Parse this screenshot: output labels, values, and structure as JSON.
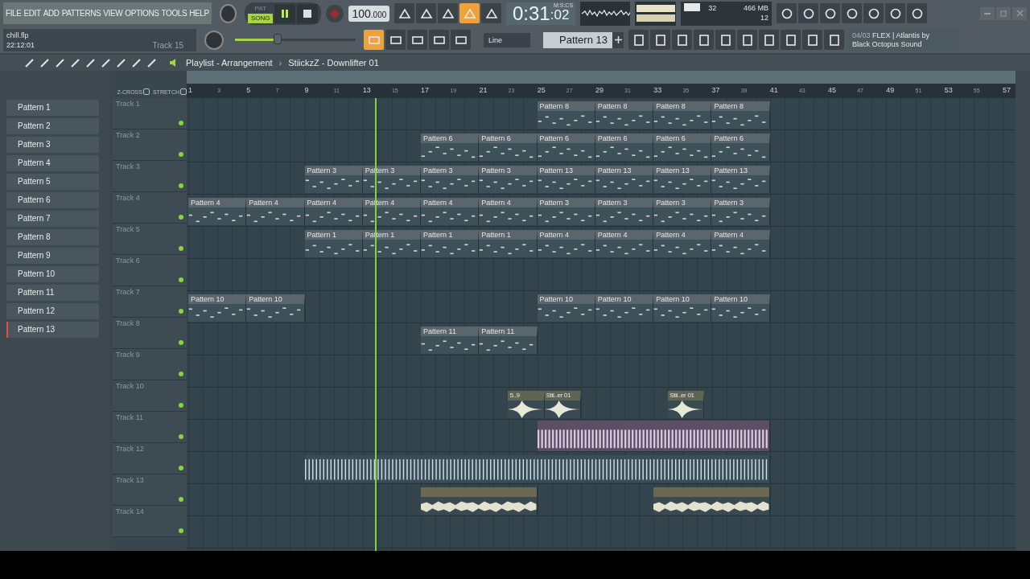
{
  "menu": [
    "FILE",
    "EDIT",
    "ADD",
    "PATTERNS",
    "VIEW",
    "OPTIONS",
    "TOOLS",
    "HELP"
  ],
  "project": {
    "file": "chill.flp",
    "time": "22:12:01",
    "hint": "Track 15"
  },
  "transport": {
    "modes": [
      {
        "label": "PAT",
        "selected": false
      },
      {
        "label": "SONG",
        "selected": true
      }
    ],
    "playing": true,
    "recording": false,
    "tempo": "100",
    "tempo_fraction": ".000"
  },
  "master_volume": {
    "level": 0.35
  },
  "clock": {
    "main": "0:31",
    "fraction": ":02",
    "unit": "M:S:CS"
  },
  "cpu": {
    "polyphony": "32",
    "memory": "466 MB",
    "voices": "12"
  },
  "snap": "Line",
  "current_pattern": "Pattern 13",
  "news": {
    "index": "04/03",
    "line1": "FLEX | Atlantis by",
    "line2": "Black Octopus Sound"
  },
  "playlist": {
    "title": "Playlist - Arrangement",
    "separator": "›",
    "clip_source": "StiickzZ - Downlifter 01",
    "options": [
      {
        "label": "Z-CROSS",
        "checked": false
      },
      {
        "label": "STRETCH",
        "checked": false
      }
    ],
    "ruler": [
      "1",
      "3",
      "5",
      "7",
      "9",
      "11",
      "13",
      "15",
      "17",
      "19",
      "21",
      "23",
      "25",
      "27",
      "29",
      "31",
      "33",
      "35",
      "37",
      "39",
      "41",
      "43",
      "45",
      "47",
      "49",
      "51",
      "53",
      "55",
      "57"
    ],
    "playhead": {
      "level": 0.227
    },
    "patterns": [
      {
        "name": "Pattern 1",
        "selected": false
      },
      {
        "name": "Pattern 2",
        "selected": false
      },
      {
        "name": "Pattern 3",
        "selected": false
      },
      {
        "name": "Pattern 4",
        "selected": false
      },
      {
        "name": "Pattern 5",
        "selected": false
      },
      {
        "name": "Pattern 6",
        "selected": false
      },
      {
        "name": "Pattern 7",
        "selected": false
      },
      {
        "name": "Pattern 8",
        "selected": false
      },
      {
        "name": "Pattern 9",
        "selected": false
      },
      {
        "name": "Pattern 10",
        "selected": false
      },
      {
        "name": "Pattern 11",
        "selected": false
      },
      {
        "name": "Pattern 12",
        "selected": false
      },
      {
        "name": "Pattern 13",
        "selected": true
      }
    ],
    "tracks": [
      {
        "name": "Track 1",
        "on": true,
        "clips": [
          {
            "kind": "gap"
          },
          {
            "kind": "gap"
          },
          {
            "kind": "gap"
          },
          {
            "kind": "gap"
          },
          {
            "kind": "gap"
          },
          {
            "kind": "gap"
          },
          {
            "kind": "pattern",
            "label": "Pattern 8"
          },
          {
            "kind": "pattern",
            "label": "Pattern 8"
          },
          {
            "kind": "pattern",
            "label": "Pattern 8"
          },
          {
            "kind": "pattern",
            "label": "Pattern 8"
          }
        ]
      },
      {
        "name": "Track 2",
        "on": true,
        "clips": [
          {
            "kind": "gap"
          },
          {
            "kind": "gap"
          },
          {
            "kind": "gap"
          },
          {
            "kind": "gap"
          },
          {
            "kind": "pattern",
            "label": "Pattern 6"
          },
          {
            "kind": "pattern",
            "label": "Pattern 6"
          },
          {
            "kind": "pattern",
            "label": "Pattern 6"
          },
          {
            "kind": "pattern",
            "label": "Pattern 6"
          },
          {
            "kind": "pattern",
            "label": "Pattern 6"
          },
          {
            "kind": "pattern",
            "label": "Pattern 6"
          }
        ]
      },
      {
        "name": "Track 3",
        "on": true,
        "clips": [
          {
            "kind": "gap"
          },
          {
            "kind": "gap"
          },
          {
            "kind": "pattern",
            "label": "Pattern 3"
          },
          {
            "kind": "pattern",
            "label": "Pattern 3"
          },
          {
            "kind": "pattern",
            "label": "Pattern 3"
          },
          {
            "kind": "pattern",
            "label": "Pattern 3"
          },
          {
            "kind": "pattern",
            "label": "Pattern 13"
          },
          {
            "kind": "pattern",
            "label": "Pattern 13"
          },
          {
            "kind": "pattern",
            "label": "Pattern 13"
          },
          {
            "kind": "pattern",
            "label": "Pattern 13"
          }
        ]
      },
      {
        "name": "Track 4",
        "on": true,
        "clips": [
          {
            "kind": "pattern",
            "label": "Pattern 4"
          },
          {
            "kind": "pattern",
            "label": "Pattern 4"
          },
          {
            "kind": "pattern",
            "label": "Pattern 4"
          },
          {
            "kind": "pattern",
            "label": "Pattern 4"
          },
          {
            "kind": "pattern",
            "label": "Pattern 4"
          },
          {
            "kind": "pattern",
            "label": "Pattern 4"
          },
          {
            "kind": "pattern",
            "label": "Pattern 3"
          },
          {
            "kind": "pattern",
            "label": "Pattern 3"
          },
          {
            "kind": "pattern",
            "label": "Pattern 3"
          },
          {
            "kind": "pattern",
            "label": "Pattern 3"
          }
        ]
      },
      {
        "name": "Track 5",
        "on": true,
        "clips": [
          {
            "kind": "gap"
          },
          {
            "kind": "gap"
          },
          {
            "kind": "pattern",
            "label": "Pattern 1"
          },
          {
            "kind": "pattern",
            "label": "Pattern 1"
          },
          {
            "kind": "pattern",
            "label": "Pattern 1"
          },
          {
            "kind": "pattern",
            "label": "Pattern 1"
          },
          {
            "kind": "pattern",
            "label": "Pattern 4"
          },
          {
            "kind": "pattern",
            "label": "Pattern 4"
          },
          {
            "kind": "pattern",
            "label": "Pattern 4"
          },
          {
            "kind": "pattern",
            "label": "Pattern 4"
          }
        ]
      },
      {
        "name": "Track 6",
        "on": true
      },
      {
        "name": "Track 7",
        "on": true,
        "clips": [
          {
            "kind": "pattern",
            "label": "Pattern 10"
          },
          {
            "kind": "pattern",
            "label": "Pattern 10"
          },
          {
            "kind": "gap"
          },
          {
            "kind": "gap"
          },
          {
            "kind": "gap"
          },
          {
            "kind": "gap"
          },
          {
            "kind": "pattern",
            "label": "Pattern 10"
          },
          {
            "kind": "pattern",
            "label": "Pattern 10"
          },
          {
            "kind": "pattern",
            "label": "Pattern 10"
          },
          {
            "kind": "pattern",
            "label": "Pattern 10"
          }
        ]
      },
      {
        "name": "Track 8",
        "on": true,
        "clips": [
          {
            "kind": "gap"
          },
          {
            "kind": "gap"
          },
          {
            "kind": "gap"
          },
          {
            "kind": "gap"
          },
          {
            "kind": "pattern",
            "label": "Pattern 11"
          },
          {
            "kind": "pattern",
            "label": "Pattern 11"
          }
        ]
      },
      {
        "name": "Track 9",
        "on": true
      },
      {
        "name": "Track 10",
        "on": true,
        "clips": [
          {
            "kind": "gap"
          },
          {
            "kind": "gap"
          },
          {
            "kind": "gap"
          },
          {
            "kind": "gap"
          },
          {
            "kind": "gap"
          },
          {
            "kind": "rest"
          },
          {
            "kind": "shot",
            "label": "5..9"
          },
          {
            "kind": "shot",
            "label": "Stii..er 01"
          },
          {
            "kind": "rest"
          },
          {
            "kind": "gap"
          },
          {
            "kind": "shot",
            "label": "Stii..er 01"
          }
        ]
      },
      {
        "name": "Track 11",
        "on": true,
        "clips": [
          {
            "kind": "gap"
          },
          {
            "kind": "gap"
          },
          {
            "kind": "gap"
          },
          {
            "kind": "gap"
          },
          {
            "kind": "gap"
          },
          {
            "kind": "gap"
          },
          {
            "kind": "pulse"
          }
        ]
      },
      {
        "name": "Track 12",
        "on": true,
        "clips": [
          {
            "kind": "gap"
          },
          {
            "kind": "gap"
          },
          {
            "kind": "ticks"
          }
        ]
      },
      {
        "name": "Track 13",
        "on": true,
        "clips": [
          {
            "kind": "gap"
          },
          {
            "kind": "gap"
          },
          {
            "kind": "gap"
          },
          {
            "kind": "gap"
          },
          {
            "kind": "noise"
          },
          {
            "kind": "gap"
          },
          {
            "kind": "gap"
          },
          {
            "kind": "noise"
          }
        ]
      },
      {
        "name": "Track 14",
        "on": true
      }
    ]
  }
}
